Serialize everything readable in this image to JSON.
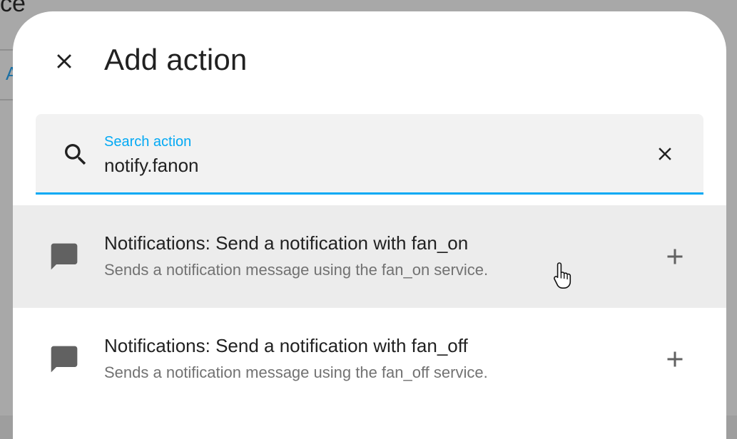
{
  "background": {
    "title_fragment": "ce",
    "tab_fragment": "A"
  },
  "dialog": {
    "title": "Add action",
    "close_icon": "close-icon"
  },
  "search": {
    "label": "Search action",
    "value": "notify.fanon",
    "icon": "search-icon",
    "clear_icon": "close-icon"
  },
  "results": [
    {
      "title": "Notifications: Send a notification with fan_on",
      "subtitle": "Sends a notification message using the fan_on service.",
      "icon": "message-icon",
      "action_icon": "plus-icon",
      "hovered": true
    },
    {
      "title": "Notifications: Send a notification with fan_off",
      "subtitle": "Sends a notification message using the fan_off service.",
      "icon": "message-icon",
      "action_icon": "plus-icon",
      "hovered": false
    }
  ],
  "colors": {
    "accent": "#03a9f4",
    "hover_row": "#ececec",
    "icon": "#616161",
    "title_text": "#212121",
    "subtitle_text": "#727272"
  }
}
